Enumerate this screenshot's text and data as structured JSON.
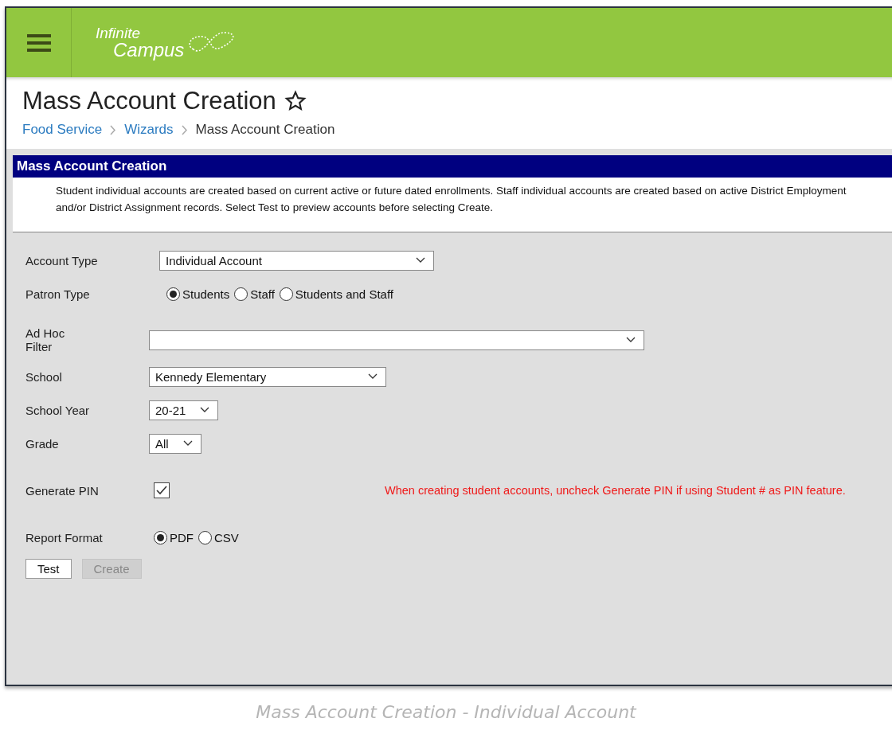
{
  "header": {
    "logo_top": "Infinite",
    "logo_bottom": "Campus"
  },
  "page": {
    "title": "Mass Account Creation",
    "favorite": false,
    "breadcrumbs": [
      {
        "label": "Food Service"
      },
      {
        "label": "Wizards"
      },
      {
        "label": "Mass Account Creation"
      }
    ]
  },
  "panel": {
    "title": "Mass Account Creation",
    "description": "Student individual accounts are created based on current active or future dated enrollments. Staff individual accounts are created based on active District Employment and/or District Assignment records. Select Test to preview accounts before selecting Create."
  },
  "fields": [
    {
      "kind": "select",
      "label": "Account Type",
      "value": "Individual Account"
    },
    {
      "kind": "radio",
      "label": "Patron Type",
      "options": [
        {
          "label": "Students",
          "selected": true
        },
        {
          "label": "Staff",
          "selected": false
        },
        {
          "label": "Students and Staff",
          "selected": false
        }
      ]
    },
    {
      "kind": "select",
      "label": "Ad Hoc Filter"
    },
    {
      "kind": "select",
      "label": "School",
      "value": "Kennedy Elementary"
    },
    {
      "kind": "select",
      "label": "School Year",
      "value": "20-21"
    },
    {
      "kind": "select",
      "label": "Grade",
      "value": "All"
    },
    {
      "kind": "checkbox",
      "label": "Generate PIN",
      "checked": true,
      "note": "When creating student accounts, uncheck Generate PIN if using Student # as PIN feature."
    },
    {
      "kind": "radio",
      "label": "Report Format",
      "options": [
        {
          "label": "PDF",
          "selected": true
        },
        {
          "label": "CSV",
          "selected": false
        }
      ]
    }
  ],
  "buttons": [
    {
      "label": "Test",
      "disabled": false
    },
    {
      "label": "Create",
      "disabled": true
    }
  ],
  "caption": "Mass Account Creation - Individual Account"
}
